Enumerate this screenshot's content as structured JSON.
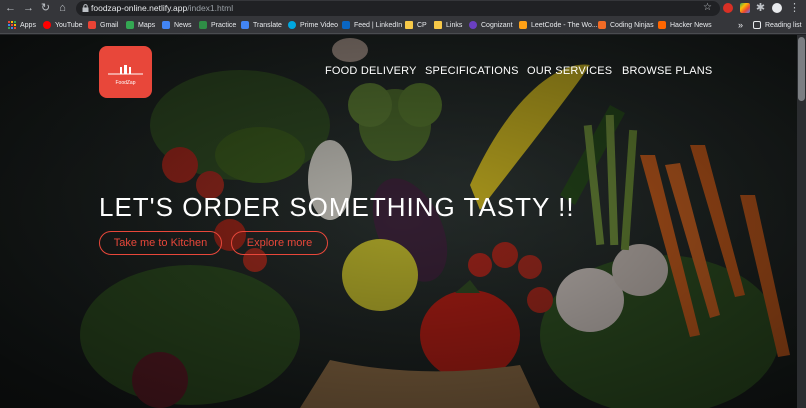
{
  "browser": {
    "url_host": "foodzap-online.netlify.app",
    "url_path": "/index1.html",
    "reading_list_label": "Reading list",
    "overflow_label": "»"
  },
  "bookmarks": [
    {
      "label": "Apps",
      "color": "#ea4335"
    },
    {
      "label": "YouTube",
      "color": "#ff0000"
    },
    {
      "label": "Gmail",
      "color": "#ea4335"
    },
    {
      "label": "Maps",
      "color": "#34a853"
    },
    {
      "label": "News",
      "color": "#4285f4"
    },
    {
      "label": "Practice",
      "color": "#2f8d46"
    },
    {
      "label": "Translate",
      "color": "#4285f4"
    },
    {
      "label": "Prime Video",
      "color": "#00a8e1"
    },
    {
      "label": "Feed | LinkedIn",
      "color": "#0a66c2"
    },
    {
      "label": "CP",
      "color": "#f7c948"
    },
    {
      "label": "Links",
      "color": "#f7c948"
    },
    {
      "label": "Cognizant",
      "color": "#6a3fc1"
    },
    {
      "label": "LeetCode - The Wo...",
      "color": "#ffa116"
    },
    {
      "label": "Coding Ninjas",
      "color": "#f26b25"
    },
    {
      "label": "Hacker News",
      "color": "#ff6600"
    }
  ],
  "site": {
    "logo_text": "FoodZap",
    "nav": [
      "FOOD DELIVERY",
      "SPECIFICATIONS",
      "OUR SERVICES",
      "BROWSE PLANS"
    ],
    "hero_title": "LET'S ORDER SOMETHING TASTY !!",
    "primary_button": "Take me to Kitchen",
    "secondary_button": "Explore more",
    "accent_color": "#e8473a"
  }
}
